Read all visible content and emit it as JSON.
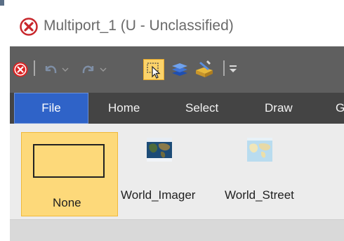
{
  "window": {
    "title": "Multiport_1 (U - Unclassified)"
  },
  "tabs": [
    {
      "label": "File",
      "active": true
    },
    {
      "label": "Home",
      "active": false
    },
    {
      "label": "Select",
      "active": false
    },
    {
      "label": "Draw",
      "active": false
    },
    {
      "label": "G",
      "active": false
    }
  ],
  "quick_access": {
    "icons": [
      "close-circle-icon",
      "undo-icon",
      "redo-icon",
      "select-pointer-icon",
      "layers-icon",
      "edit-tool-icon",
      "customize-icon"
    ]
  },
  "basemap_gallery": {
    "items": [
      {
        "label": "None",
        "selected": true
      },
      {
        "label": "World_Imager",
        "selected": false
      },
      {
        "label": "World_Street",
        "selected": false
      }
    ]
  },
  "colors": {
    "accent_tab": "#2f63c8",
    "selected_item": "#fdd97a",
    "qat_bg": "#5f5f5f",
    "tabs_bg": "#444444"
  }
}
